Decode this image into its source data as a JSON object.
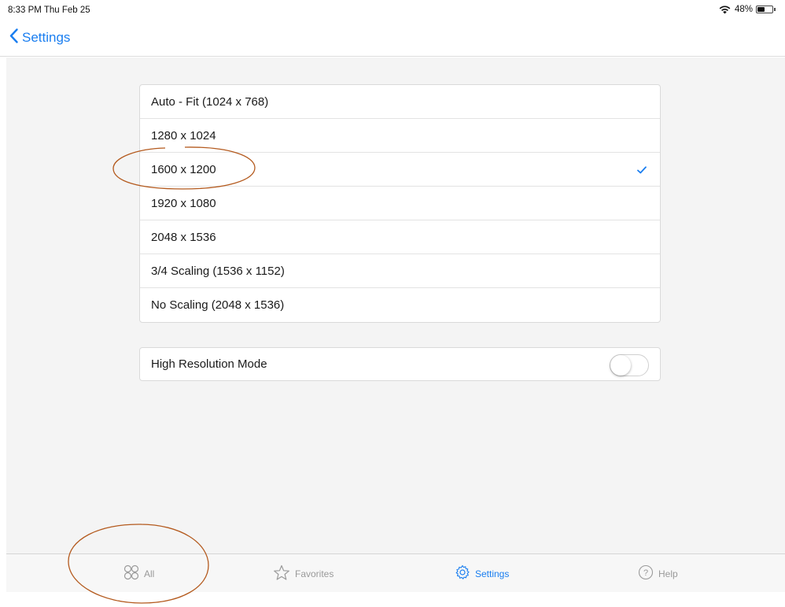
{
  "status_bar": {
    "time_date": "8:33 PM  Thu Feb 25",
    "battery_text": "48%",
    "battery_level": 0.48
  },
  "nav": {
    "back_label": "Settings"
  },
  "resolutions": [
    {
      "label": "Auto - Fit (1024 x 768)",
      "selected": false
    },
    {
      "label": "1280 x 1024",
      "selected": false
    },
    {
      "label": "1600 x 1200",
      "selected": true
    },
    {
      "label": "1920 x 1080",
      "selected": false
    },
    {
      "label": "2048 x 1536",
      "selected": false
    },
    {
      "label": "3/4 Scaling (1536 x 1152)",
      "selected": false
    },
    {
      "label": "No Scaling (2048 x 1536)",
      "selected": false
    }
  ],
  "high_res": {
    "label": "High Resolution Mode",
    "enabled": false
  },
  "tabs": [
    {
      "label": "All",
      "icon": "grid-circles-icon",
      "active": false
    },
    {
      "label": "Favorites",
      "icon": "star-icon",
      "active": false
    },
    {
      "label": "Settings",
      "icon": "gear-icon",
      "active": true
    },
    {
      "label": "Help",
      "icon": "help-circle-icon",
      "active": false
    }
  ],
  "colors": {
    "accent": "#1a7ef0",
    "annotation": "#b45a1e",
    "background": "#f4f4f4"
  }
}
